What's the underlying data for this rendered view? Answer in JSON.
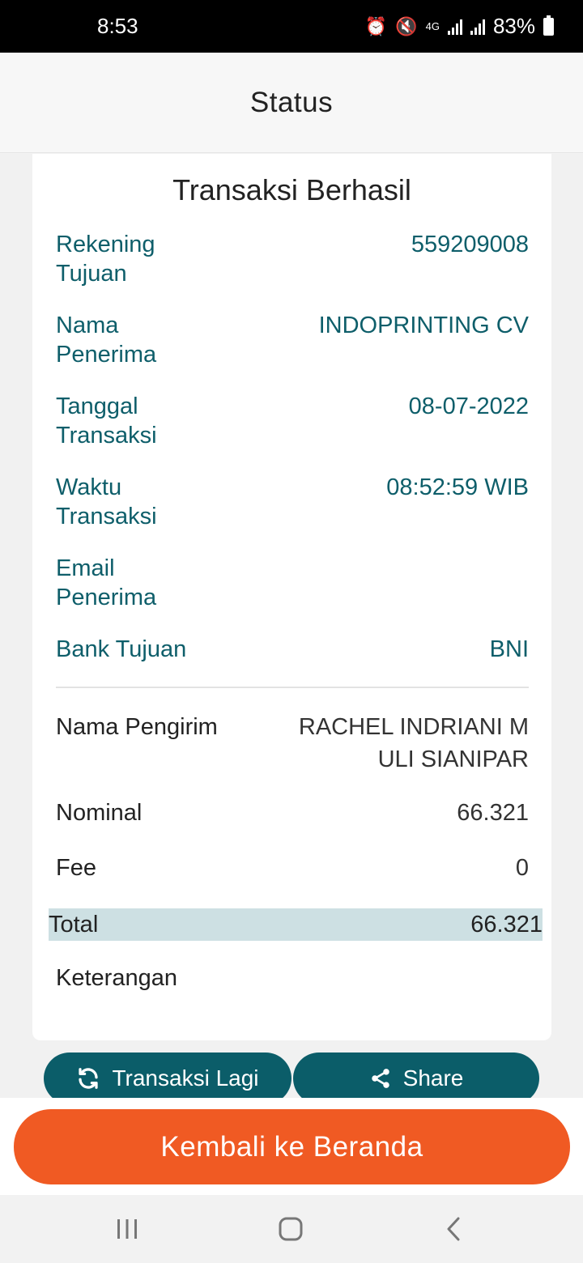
{
  "status_bar": {
    "time": "8:53",
    "network": "4G",
    "battery": "83%"
  },
  "header": {
    "title": "Status"
  },
  "card": {
    "title": "Transaksi Berhasil",
    "recipient_rows": [
      {
        "label": "Rekening Tujuan",
        "value": "559209008"
      },
      {
        "label": "Nama Penerima",
        "value": "INDOPRINTING CV"
      },
      {
        "label": "Tanggal Transaksi",
        "value": "08-07-2022"
      },
      {
        "label": "Waktu Transaksi",
        "value": "08:52:59 WIB"
      },
      {
        "label": "Email Penerima",
        "value": ""
      },
      {
        "label": "Bank Tujuan",
        "value": "BNI"
      }
    ],
    "sender_name": {
      "label": "Nama Pengirim",
      "value": "RACHEL INDRIANI M ULI SIANIPAR"
    },
    "nominal": {
      "label": "Nominal",
      "value": "66.321"
    },
    "fee": {
      "label": "Fee",
      "value": "0"
    },
    "total": {
      "label": "Total",
      "value": "66.321"
    },
    "keterangan": {
      "label": "Keterangan",
      "value": ""
    }
  },
  "actions": {
    "retry_label": "Transaksi Lagi",
    "share_label": "Share",
    "home_label": "Kembali ke Beranda"
  },
  "colors": {
    "teal": "#0b5d69",
    "orange": "#f05a23",
    "total_highlight": "#cde0e3"
  }
}
